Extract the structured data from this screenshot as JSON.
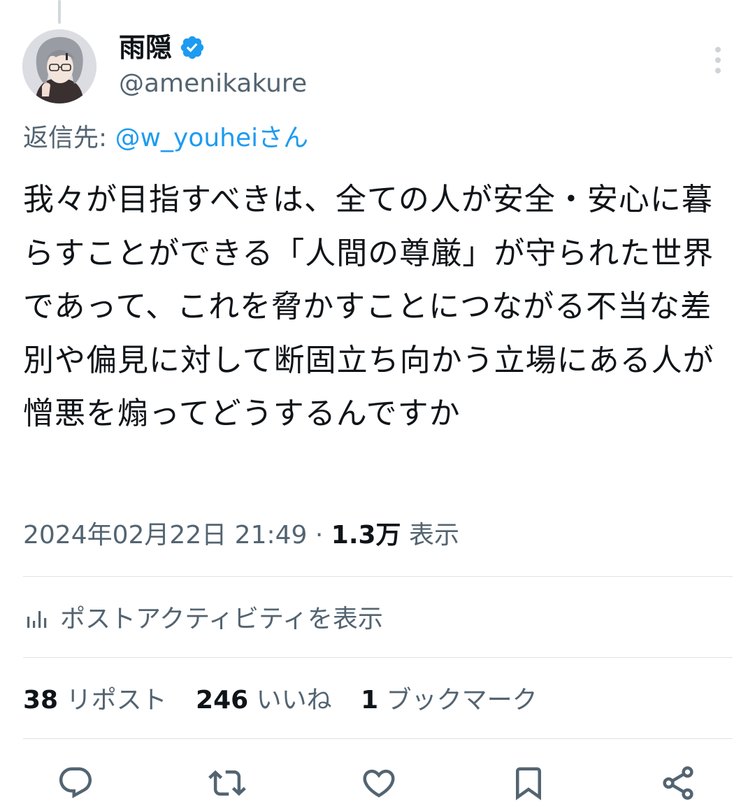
{
  "author": {
    "display_name": "雨隠",
    "handle": "@amenikakure",
    "verified": true,
    "avatar_icon": "avatar-illustration"
  },
  "reply": {
    "prefix": "返信先: ",
    "mention": "@w_youheiさん"
  },
  "tweet": {
    "text": "我々が目指すべきは、全ての人が安全・安心に暮らすことができる「人間の尊厳」が守られた世界であって、これを脅かすことにつながる不当な差別や偏見に対して断固立ち向かう立場にある人が憎悪を煽ってどうするんですか"
  },
  "meta": {
    "timestamp": "2024年02月22日 21:49",
    "separator": " · ",
    "views_count": "1.3万",
    "views_label": " 表示"
  },
  "activity": {
    "label": "ポストアクティビティを表示",
    "icon": "analytics-icon"
  },
  "stats": [
    {
      "count": "38",
      "label": "リポスト"
    },
    {
      "count": "246",
      "label": "いいね"
    },
    {
      "count": "1",
      "label": "ブックマーク"
    }
  ],
  "actions": [
    {
      "name": "reply",
      "icon": "reply-icon"
    },
    {
      "name": "repost",
      "icon": "repost-icon"
    },
    {
      "name": "like",
      "icon": "heart-icon"
    },
    {
      "name": "bookmark",
      "icon": "bookmark-icon"
    },
    {
      "name": "share",
      "icon": "share-icon"
    }
  ],
  "colors": {
    "text": "#0f1419",
    "secondary": "#536471",
    "link": "#1d9bf0",
    "divider": "#dfe3e6"
  }
}
